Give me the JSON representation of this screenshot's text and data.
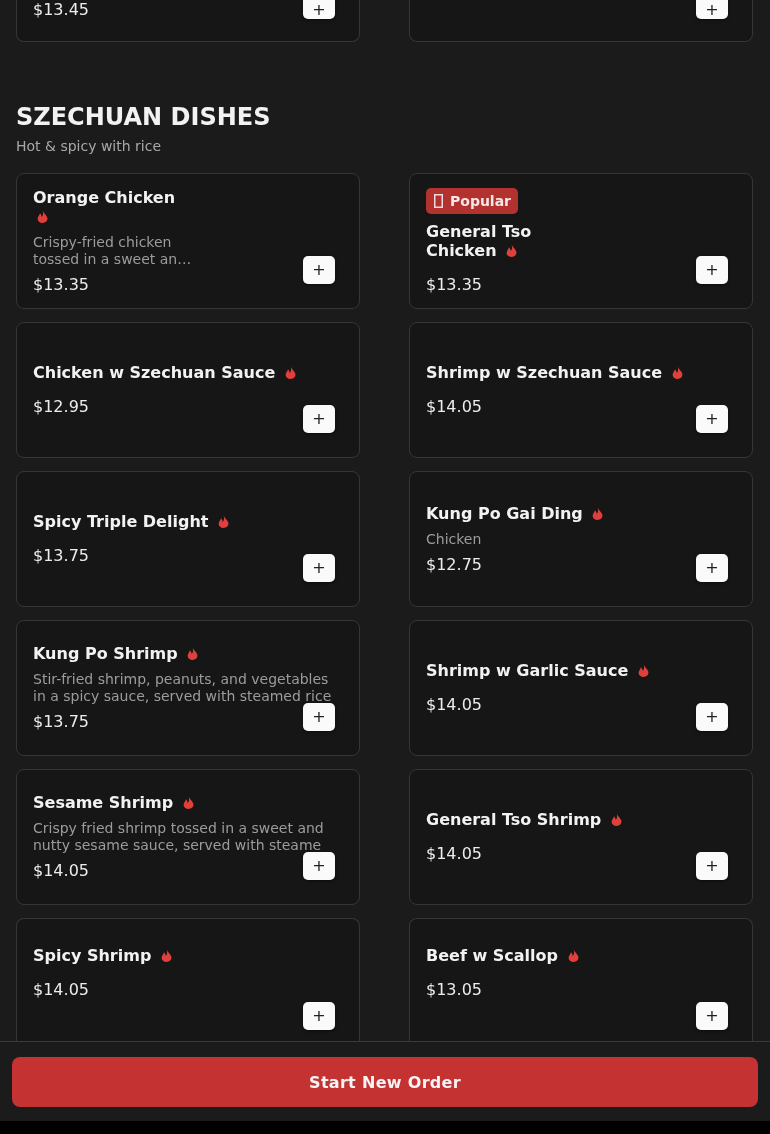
{
  "previous_section": {
    "items": [
      {
        "price": "$13.45",
        "add_button": "+"
      },
      {
        "add_button": "+"
      }
    ]
  },
  "section": {
    "title": "SZECHUAN DISHES",
    "subtitle": "Hot & spicy with rice",
    "items": [
      {
        "name": "Orange Chicken",
        "spicy": true,
        "description": "Crispy-fried chicken tossed in a sweet an…",
        "price": "$13.35",
        "add_button": "+"
      },
      {
        "badge": "Popular",
        "name": "General Tso Chicken",
        "spicy": true,
        "price": "$13.35",
        "add_button": "+"
      },
      {
        "name": "Chicken w Szechuan Sauce",
        "spicy": true,
        "price": "$12.95",
        "add_button": "+"
      },
      {
        "name": "Shrimp w Szechuan Sauce",
        "spicy": true,
        "price": "$14.05",
        "add_button": "+"
      },
      {
        "name": "Spicy Triple Delight",
        "spicy": true,
        "price": "$13.75",
        "add_button": "+"
      },
      {
        "name": "Kung Po Gai Ding",
        "spicy": true,
        "description": "Chicken",
        "price": "$12.75",
        "add_button": "+"
      },
      {
        "name": "Kung Po Shrimp",
        "spicy": true,
        "description": "Stir-fried shrimp, peanuts, and vegetables in a spicy sauce, served with steamed rice",
        "price": "$13.75",
        "add_button": "+"
      },
      {
        "name": "Shrimp w Garlic Sauce",
        "spicy": true,
        "price": "$14.05",
        "add_button": "+"
      },
      {
        "name": "Sesame Shrimp",
        "spicy": true,
        "description": "Crispy fried shrimp tossed in a sweet and nutty sesame sauce, served with steame",
        "price": "$14.05",
        "add_button": "+"
      },
      {
        "name": "General Tso Shrimp",
        "spicy": true,
        "price": "$14.05",
        "add_button": "+"
      },
      {
        "name": "Spicy Shrimp",
        "spicy": true,
        "price": "$14.05",
        "add_button": "+"
      },
      {
        "name": "Beef w Scallop",
        "spicy": true,
        "price": "$13.05",
        "add_button": "+"
      }
    ]
  },
  "start_button": "Start New Order"
}
